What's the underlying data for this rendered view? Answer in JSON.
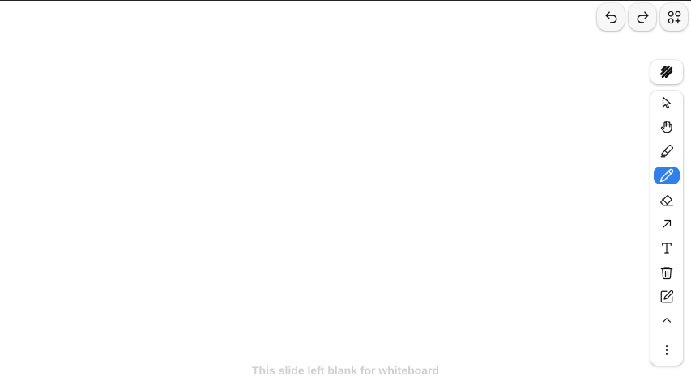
{
  "top_actions": {
    "undo_icon": "undo-icon",
    "redo_icon": "redo-icon",
    "add_shapes_icon": "shapes-plus-icon"
  },
  "style_panel": {
    "icon": "scribble-icon"
  },
  "toolbar": {
    "tools": [
      {
        "name": "select",
        "icon": "pointer-icon",
        "active": false
      },
      {
        "name": "hand",
        "icon": "hand-icon",
        "active": false
      },
      {
        "name": "highlighter",
        "icon": "highlighter-icon",
        "active": false
      },
      {
        "name": "draw",
        "icon": "pencil-icon",
        "active": true
      },
      {
        "name": "eraser",
        "icon": "eraser-icon",
        "active": false
      },
      {
        "name": "arrow",
        "icon": "arrow-icon",
        "active": false
      },
      {
        "name": "text",
        "icon": "text-icon",
        "active": false
      },
      {
        "name": "delete",
        "icon": "trash-icon",
        "active": false
      },
      {
        "name": "note",
        "icon": "edit-note-icon",
        "active": false
      },
      {
        "name": "collapse",
        "icon": "chevron-up-icon",
        "active": false
      },
      {
        "name": "more",
        "icon": "more-vertical-icon",
        "active": false
      }
    ],
    "active_color": "#2f80ed"
  },
  "slide": {
    "caption": "This slide left blank for whiteboard"
  }
}
